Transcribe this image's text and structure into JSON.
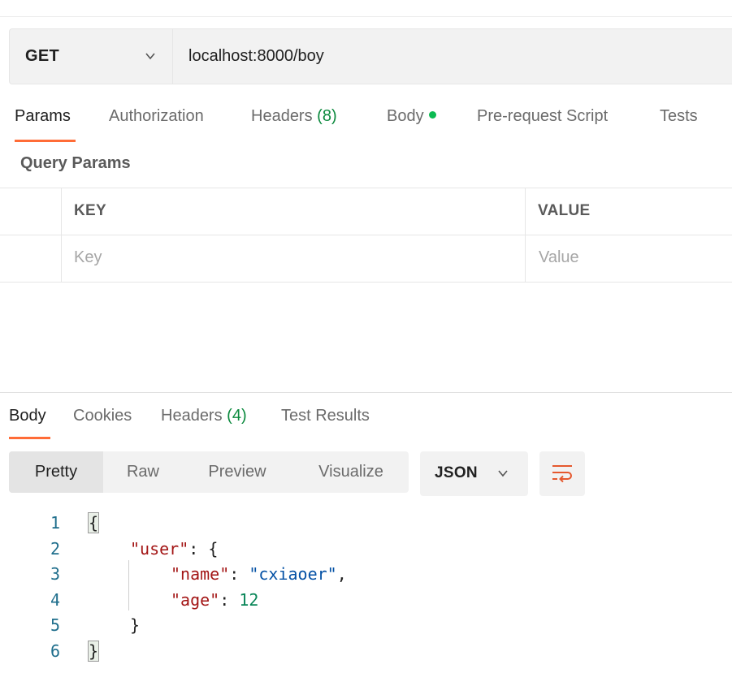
{
  "request": {
    "method": "GET",
    "url": "localhost:8000/boy"
  },
  "request_tabs": [
    {
      "label": "Params",
      "active": true
    },
    {
      "label": "Authorization"
    },
    {
      "label": "Headers",
      "count": "(8)"
    },
    {
      "label": "Body",
      "indicator": "dot"
    },
    {
      "label": "Pre-request Script"
    },
    {
      "label": "Tests"
    }
  ],
  "params": {
    "title": "Query Params",
    "columns": [
      "KEY",
      "VALUE"
    ],
    "key_placeholder": "Key",
    "value_placeholder": "Value"
  },
  "response_tabs": [
    {
      "label": "Body",
      "active": true
    },
    {
      "label": "Cookies"
    },
    {
      "label": "Headers",
      "count": "(4)"
    },
    {
      "label": "Test Results"
    }
  ],
  "view_modes": [
    "Pretty",
    "Raw",
    "Preview",
    "Visualize"
  ],
  "active_view": "Pretty",
  "format": "JSON",
  "icons": {
    "method_dropdown": "chevron-down-icon",
    "format_dropdown": "chevron-down-icon",
    "wrap": "wrap-lines-icon"
  },
  "colors": {
    "accent": "#ff6c37",
    "count": "#0c8a3e",
    "dot": "#0cbb52",
    "json_key": "#a31515",
    "json_string": "#0451a5",
    "json_number": "#098658"
  },
  "response_body": {
    "line_numbers": [
      "1",
      "2",
      "3",
      "4",
      "5",
      "6"
    ],
    "open_brace": "{",
    "close_brace": "}",
    "user_key": "\"user\"",
    "name_key": "\"name\"",
    "name_value": "\"cxiaoer\"",
    "age_key": "\"age\"",
    "age_value": "12"
  }
}
